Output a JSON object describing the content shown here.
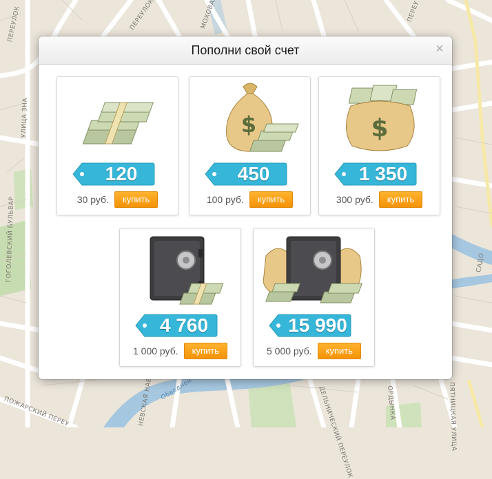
{
  "map": {
    "labels": [
      "ПЕРЕУЛОК",
      "ПЕРЕУЛОК",
      "МОХОВАЯ УЛИЦА",
      "УЛИЦА ЗНА",
      "ГОГОЛЕВСКИЙ БУЛЬВАР",
      "ПОЖАРСКИЙ ПЕРЕУ",
      "НЕВСКАЯ НАБ",
      "ДЕЛЬНИЧЕСКИЙ ПЕРЕУЛОК",
      "ОРДЫНКА",
      "ПЯТНИЦКАЯ УЛИЦА",
      "САДО",
      "ПЕРЕУ",
      "Обводной канал"
    ]
  },
  "modal": {
    "title": "Пополни свой счет",
    "close_icon": "×"
  },
  "packages": [
    {
      "amount": "120",
      "price": "30 руб.",
      "buy_label": "купить",
      "art": "cash-stack-icon"
    },
    {
      "amount": "450",
      "price": "100 руб.",
      "buy_label": "купить",
      "art": "money-bag-icon"
    },
    {
      "amount": "1 350",
      "price": "300 руб.",
      "buy_label": "купить",
      "art": "big-money-bag-icon"
    },
    {
      "amount": "4 760",
      "price": "1 000 руб.",
      "buy_label": "купить",
      "art": "safe-icon"
    },
    {
      "amount": "15 990",
      "price": "5 000 руб.",
      "buy_label": "купить",
      "art": "safe-with-bags-icon"
    }
  ],
  "colors": {
    "tag": "#36b6d8",
    "button": "#f7a11b",
    "map_bg": "#ebe5da"
  }
}
